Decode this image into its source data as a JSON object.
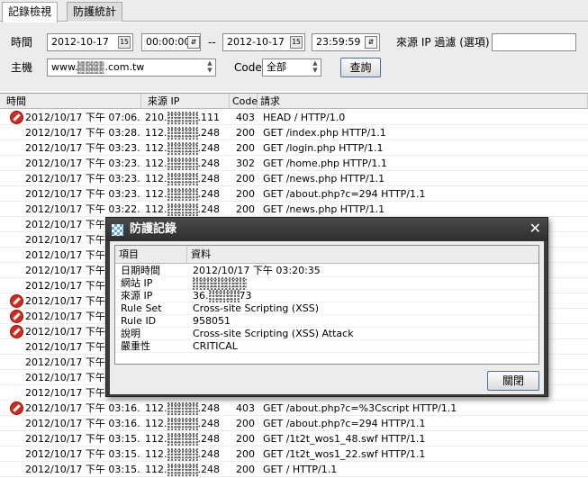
{
  "tabs": [
    {
      "label": "記錄檢視"
    },
    {
      "label": "防護統計"
    }
  ],
  "filter": {
    "time_label": "時間",
    "start_date": "2012-10-17",
    "start_time": "00:00:00",
    "range_separator": "--",
    "end_date": "2012-10-17",
    "end_time": "23:59:59",
    "source_ip_label": "來源 IP 過濾 (選項)",
    "source_ip_value": "",
    "host_label": "主機",
    "host_value_prefix": "www.",
    "host_value_suffix": ".com.tw",
    "code_label": "Code",
    "code_value": "全部",
    "query_button": "查詢"
  },
  "table": {
    "columns": [
      "時間",
      "來源 IP",
      "Code",
      "請求"
    ],
    "rows": [
      {
        "blocked": true,
        "time": "2012/10/17 下午 07:06...",
        "ip_prefix": "210.",
        "ip_suffix": ".111",
        "code": "403",
        "request": "HEAD / HTTP/1.0"
      },
      {
        "blocked": false,
        "time": "2012/10/17 下午 03:28...",
        "ip_prefix": "112.",
        "ip_suffix": ".248",
        "code": "200",
        "request": "GET /index.php HTTP/1.1"
      },
      {
        "blocked": false,
        "time": "2012/10/17 下午 03:23...",
        "ip_prefix": "112.",
        "ip_suffix": ".248",
        "code": "200",
        "request": "GET /login.php HTTP/1.1"
      },
      {
        "blocked": false,
        "time": "2012/10/17 下午 03:23...",
        "ip_prefix": "112.",
        "ip_suffix": ".248",
        "code": "302",
        "request": "GET /home.php HTTP/1.1"
      },
      {
        "blocked": false,
        "time": "2012/10/17 下午 03:23...",
        "ip_prefix": "112.",
        "ip_suffix": ".248",
        "code": "200",
        "request": "GET /news.php HTTP/1.1"
      },
      {
        "blocked": false,
        "time": "2012/10/17 下午 03:23...",
        "ip_prefix": "112.",
        "ip_suffix": ".248",
        "code": "200",
        "request": "GET /about.php?c=294 HTTP/1.1"
      },
      {
        "blocked": false,
        "time": "2012/10/17 下午 03:22...",
        "ip_prefix": "112.",
        "ip_suffix": ".248",
        "code": "200",
        "request": "GET /news.php HTTP/1.1"
      },
      {
        "blocked": false,
        "time": "2012/10/17 下午 0",
        "ip_prefix": "",
        "ip_suffix": "",
        "code": "",
        "request": ""
      },
      {
        "blocked": false,
        "time": "2012/10/17 下午 0",
        "ip_prefix": "",
        "ip_suffix": "",
        "code": "",
        "request": ""
      },
      {
        "blocked": false,
        "time": "2012/10/17 下午 0",
        "ip_prefix": "",
        "ip_suffix": "",
        "code": "",
        "request": ""
      },
      {
        "blocked": false,
        "time": "2012/10/17 下午 0",
        "ip_prefix": "",
        "ip_suffix": "",
        "code": "",
        "request": ""
      },
      {
        "blocked": false,
        "time": "2012/10/17 下午 0",
        "ip_prefix": "",
        "ip_suffix": "",
        "code": "",
        "request": ""
      },
      {
        "blocked": true,
        "time": "2012/10/17 下午 0",
        "ip_prefix": "",
        "ip_suffix": "",
        "code": "",
        "request": ""
      },
      {
        "blocked": true,
        "time": "2012/10/17 下午 0",
        "ip_prefix": "",
        "ip_suffix": "",
        "code": "",
        "request": ""
      },
      {
        "blocked": true,
        "time": "2012/10/17 下午 0",
        "ip_prefix": "",
        "ip_suffix": "",
        "code": "",
        "request": ""
      },
      {
        "blocked": false,
        "time": "2012/10/17 下午 0",
        "ip_prefix": "",
        "ip_suffix": "",
        "code": "",
        "request": ""
      },
      {
        "blocked": false,
        "time": "2012/10/17 下午 0",
        "ip_prefix": "",
        "ip_suffix": "",
        "code": "",
        "request": ""
      },
      {
        "blocked": false,
        "time": "2012/10/17 下午 0",
        "ip_prefix": "",
        "ip_suffix": "",
        "code": "",
        "request": ""
      },
      {
        "blocked": false,
        "time": "2012/10/17 下午 0",
        "ip_prefix": "",
        "ip_suffix": "",
        "code": "",
        "request": ""
      },
      {
        "blocked": true,
        "time": "2012/10/17 下午 03:16...",
        "ip_prefix": "112.",
        "ip_suffix": ".248",
        "code": "403",
        "request": "GET /about.php?c=%3Cscript HTTP/1.1"
      },
      {
        "blocked": false,
        "time": "2012/10/17 下午 03:16...",
        "ip_prefix": "112.",
        "ip_suffix": ".248",
        "code": "200",
        "request": "GET /about.php?c=294 HTTP/1.1"
      },
      {
        "blocked": false,
        "time": "2012/10/17 下午 03:15...",
        "ip_prefix": "112.",
        "ip_suffix": ".248",
        "code": "200",
        "request": "GET /1t2t_wos1_48.swf HTTP/1.1"
      },
      {
        "blocked": false,
        "time": "2012/10/17 下午 03:15...",
        "ip_prefix": "112.",
        "ip_suffix": ".248",
        "code": "200",
        "request": "GET /1t2t_wos1_22.swf HTTP/1.1"
      },
      {
        "blocked": false,
        "time": "2012/10/17 下午 03:15...",
        "ip_prefix": "112.",
        "ip_suffix": ".248",
        "code": "200",
        "request": "GET / HTTP/1.1"
      }
    ]
  },
  "dialog": {
    "title": "防護記錄",
    "columns": [
      "項目",
      "資料"
    ],
    "fields": [
      {
        "key": "日期時間",
        "value": "2012/10/17 下午 03:20:35"
      },
      {
        "key": "網站 IP",
        "value": ""
      },
      {
        "key": "來源 IP",
        "value_prefix": "36.",
        "value_suffix": "73"
      },
      {
        "key": "Rule Set",
        "value": "Cross-site Scripting (XSS)"
      },
      {
        "key": "Rule ID",
        "value": "958051"
      },
      {
        "key": "說明",
        "value": "Cross-site Scripting (XSS) Attack"
      },
      {
        "key": "嚴重性",
        "value": "CRITICAL"
      }
    ],
    "close_button": "關閉"
  }
}
